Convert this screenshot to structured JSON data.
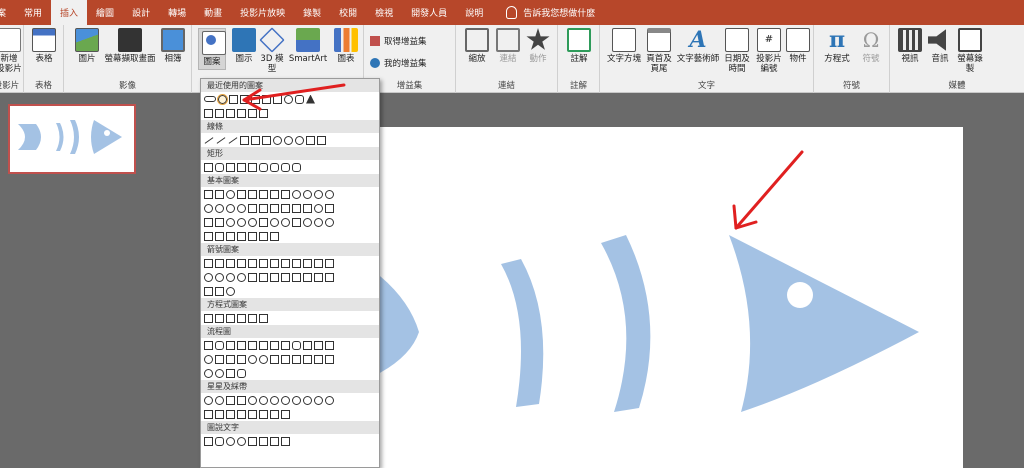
{
  "menu": {
    "tabs": [
      "檔案",
      "常用",
      "插入",
      "繪圖",
      "設計",
      "轉場",
      "動畫",
      "投影片放映",
      "錄製",
      "校閱",
      "檢視",
      "開發人員",
      "說明"
    ],
    "active_tab": "插入",
    "search": "告訴我您想做什麼"
  },
  "ribbon": {
    "groups": {
      "slides": "投影片",
      "tables": "表格",
      "images": "影像",
      "illustrations": "",
      "addins": "增益集",
      "links": "連結",
      "comments": "註解",
      "text": "文字",
      "symbols": "符號",
      "media": "媒體"
    },
    "buttons": {
      "new_slide": "新增\n投影片",
      "table": "表格",
      "pictures": "圖片",
      "screenshot": "螢幕擷取畫面",
      "album": "相簿",
      "shapes": "圖案",
      "icons": "圖示",
      "models3d": "3D 模型",
      "smartart": "SmartArt",
      "chart": "圖表",
      "get_addins": "取得增益集",
      "my_addins": "我的增益集",
      "zoom": "縮放",
      "link": "連結",
      "action": "動作",
      "comment": "註解",
      "textbox": "文字方塊",
      "header_footer": "頁首及頁尾",
      "wordart": "文字藝術師",
      "date_time": "日期及時間",
      "slide_number": "投影片編號",
      "object": "物件",
      "equation": "方程式",
      "symbol": "符號",
      "video": "視訊",
      "audio": "音訊",
      "screen_recording": "螢幕錄製"
    }
  },
  "shapes_menu": {
    "sections": [
      "最近使用的圖案",
      "線條",
      "矩形",
      "基本圖案",
      "箭號圖案",
      "方程式圖案",
      "流程圖",
      "星星及綵帶",
      "圖說文字"
    ]
  },
  "colors": {
    "accent": "#b7472a",
    "fish": "#a4c2e4",
    "arrow": "#e02020"
  },
  "slide": {
    "content": "fish-bone shapes"
  }
}
